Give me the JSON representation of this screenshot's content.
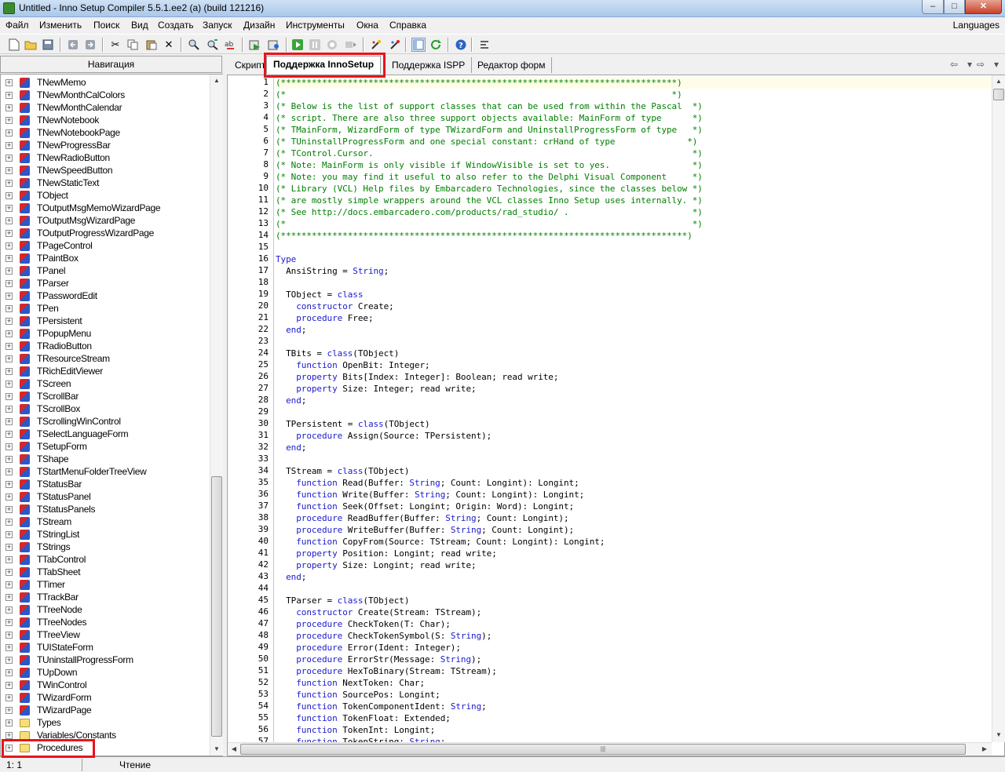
{
  "window": {
    "title": "Untitled - Inno Setup Compiler 5.5.1.ee2 (a) (build 121216)",
    "controls": {
      "minimize": "–",
      "maximize": "□",
      "close": "✕"
    }
  },
  "menu": {
    "items": [
      "Файл",
      "Изменить",
      "Поиск",
      "Вид",
      "Создать",
      "Запуск",
      "Дизайн",
      "Инструменты",
      "Окна",
      "Справка"
    ],
    "languages": "Languages"
  },
  "toolbar": {
    "icons": [
      "new-file-icon",
      "open-folder-icon",
      "save-icon",
      "undo-icon",
      "redo-icon",
      "cut-icon",
      "copy-icon",
      "paste-icon",
      "delete-icon",
      "find-icon",
      "find-next-icon",
      "replace-icon",
      "compile-icon",
      "compile-options-icon",
      "run-icon",
      "pause-icon",
      "stop-icon",
      "step-icon",
      "wizard-icon",
      "wizard-alt-icon",
      "toggle-panel-icon",
      "refresh-icon",
      "help-icon",
      "settings-icon"
    ]
  },
  "navigation": {
    "header": "Навигация",
    "items": [
      {
        "label": "TNewMemo",
        "type": "class"
      },
      {
        "label": "TNewMonthCalColors",
        "type": "class"
      },
      {
        "label": "TNewMonthCalendar",
        "type": "class"
      },
      {
        "label": "TNewNotebook",
        "type": "class"
      },
      {
        "label": "TNewNotebookPage",
        "type": "class"
      },
      {
        "label": "TNewProgressBar",
        "type": "class"
      },
      {
        "label": "TNewRadioButton",
        "type": "class"
      },
      {
        "label": "TNewSpeedButton",
        "type": "class"
      },
      {
        "label": "TNewStaticText",
        "type": "class"
      },
      {
        "label": "TObject",
        "type": "class"
      },
      {
        "label": "TOutputMsgMemoWizardPage",
        "type": "class"
      },
      {
        "label": "TOutputMsgWizardPage",
        "type": "class"
      },
      {
        "label": "TOutputProgressWizardPage",
        "type": "class"
      },
      {
        "label": "TPageControl",
        "type": "class"
      },
      {
        "label": "TPaintBox",
        "type": "class"
      },
      {
        "label": "TPanel",
        "type": "class"
      },
      {
        "label": "TParser",
        "type": "class"
      },
      {
        "label": "TPasswordEdit",
        "type": "class"
      },
      {
        "label": "TPen",
        "type": "class"
      },
      {
        "label": "TPersistent",
        "type": "class"
      },
      {
        "label": "TPopupMenu",
        "type": "class"
      },
      {
        "label": "TRadioButton",
        "type": "class"
      },
      {
        "label": "TResourceStream",
        "type": "class"
      },
      {
        "label": "TRichEditViewer",
        "type": "class"
      },
      {
        "label": "TScreen",
        "type": "class"
      },
      {
        "label": "TScrollBar",
        "type": "class"
      },
      {
        "label": "TScrollBox",
        "type": "class"
      },
      {
        "label": "TScrollingWinControl",
        "type": "class"
      },
      {
        "label": "TSelectLanguageForm",
        "type": "class"
      },
      {
        "label": "TSetupForm",
        "type": "class"
      },
      {
        "label": "TShape",
        "type": "class"
      },
      {
        "label": "TStartMenuFolderTreeView",
        "type": "class"
      },
      {
        "label": "TStatusBar",
        "type": "class"
      },
      {
        "label": "TStatusPanel",
        "type": "class"
      },
      {
        "label": "TStatusPanels",
        "type": "class"
      },
      {
        "label": "TStream",
        "type": "class"
      },
      {
        "label": "TStringList",
        "type": "class"
      },
      {
        "label": "TStrings",
        "type": "class"
      },
      {
        "label": "TTabControl",
        "type": "class"
      },
      {
        "label": "TTabSheet",
        "type": "class"
      },
      {
        "label": "TTimer",
        "type": "class"
      },
      {
        "label": "TTrackBar",
        "type": "class"
      },
      {
        "label": "TTreeNode",
        "type": "class"
      },
      {
        "label": "TTreeNodes",
        "type": "class"
      },
      {
        "label": "TTreeView",
        "type": "class"
      },
      {
        "label": "TUIStateForm",
        "type": "class"
      },
      {
        "label": "TUninstallProgressForm",
        "type": "class"
      },
      {
        "label": "TUpDown",
        "type": "class"
      },
      {
        "label": "TWinControl",
        "type": "class"
      },
      {
        "label": "TWizardForm",
        "type": "class"
      },
      {
        "label": "TWizardPage",
        "type": "class"
      },
      {
        "label": "Types",
        "type": "folder"
      },
      {
        "label": "Variables/Constants",
        "type": "folder"
      },
      {
        "label": "Procedures",
        "type": "folder"
      }
    ]
  },
  "tabs": [
    {
      "label": "Скрипт",
      "active": false
    },
    {
      "label": "Поддержка InnoSetup",
      "active": true
    },
    {
      "label": "Поддержка ISPP",
      "active": false
    },
    {
      "label": "Редактор форм",
      "active": false
    }
  ],
  "tab_nav": {
    "back": "⇦",
    "back_menu": "▾",
    "forward": "⇨",
    "forward_menu": "▾"
  },
  "scroll_glyphs": {
    "up": "▲",
    "down": "▼",
    "grip": "|||"
  },
  "editor": {
    "lines": [
      "(*****************************************************************************)",
      "(*                                                                           *)",
      "(* Below is the list of support classes that can be used from within the Pascal  *)",
      "(* script. There are also three support objects available: MainForm of type      *)",
      "(* TMainForm, WizardForm of type TWizardForm and UninstallProgressForm of type   *)",
      "(* TUninstallProgressForm and one special constant: crHand of type              *)",
      "(* TControl.Cursor.                                                              *)",
      "(* Note: MainForm is only visible if WindowVisible is set to yes.                *)",
      "(* Note: you may find it useful to also refer to the Delphi Visual Component     *)",
      "(* Library (VCL) Help files by Embarcadero Technologies, since the classes below *)",
      "(* are mostly simple wrappers around the VCL classes Inno Setup uses internally. *)",
      "(* See http://docs.embarcadero.com/products/rad_studio/ .                        *)",
      "(*                                                                               *)",
      "(*******************************************************************************)",
      "",
      "Type",
      "  AnsiString = String;",
      "",
      "  TObject = class",
      "    constructor Create;",
      "    procedure Free;",
      "  end;",
      "",
      "  TBits = class(TObject)",
      "    function OpenBit: Integer;",
      "    property Bits[Index: Integer]: Boolean; read write;",
      "    property Size: Integer; read write;",
      "  end;",
      "",
      "  TPersistent = class(TObject)",
      "    procedure Assign(Source: TPersistent);",
      "  end;",
      "",
      "  TStream = class(TObject)",
      "    function Read(Buffer: String; Count: Longint): Longint;",
      "    function Write(Buffer: String; Count: Longint): Longint;",
      "    function Seek(Offset: Longint; Origin: Word): Longint;",
      "    procedure ReadBuffer(Buffer: String; Count: Longint);",
      "    procedure WriteBuffer(Buffer: String; Count: Longint);",
      "    function CopyFrom(Source: TStream; Count: Longint): Longint;",
      "    property Position: Longint; read write;",
      "    property Size: Longint; read write;",
      "  end;",
      "",
      "  TParser = class(TObject)",
      "    constructor Create(Stream: TStream);",
      "    procedure CheckToken(T: Char);",
      "    procedure CheckTokenSymbol(S: String);",
      "    procedure Error(Ident: Integer);",
      "    procedure ErrorStr(Message: String);",
      "    procedure HexToBinary(Stream: TStream);",
      "    function NextToken: Char;",
      "    function SourcePos: Longint;",
      "    function TokenComponentIdent: String;",
      "    function TokenFloat: Extended;",
      "    function TokenInt: Longint;",
      "    function TokenString: String;"
    ]
  },
  "status": {
    "position": "1:  1",
    "mode": "Чтение"
  }
}
